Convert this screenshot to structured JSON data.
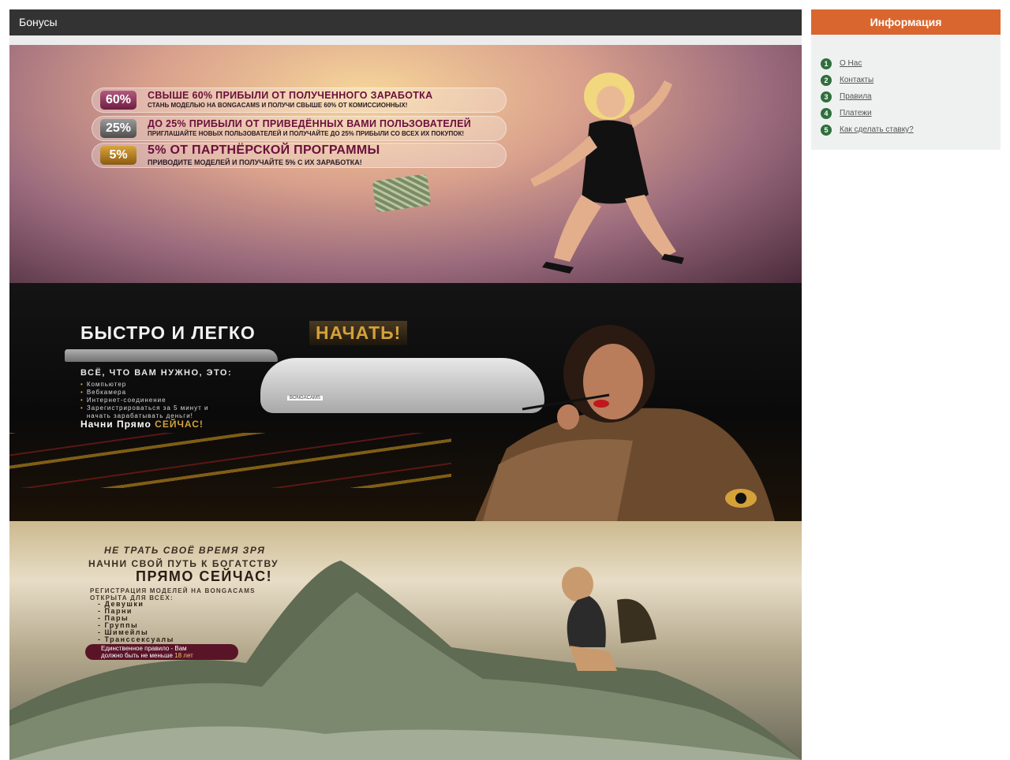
{
  "main": {
    "title": "Бонусы",
    "banners": [
      {
        "rows": [
          {
            "badge": "60%",
            "title": "СВЫШЕ 60% ПРИБЫЛИ ОТ ПОЛУЧЕННОГО ЗАРАБОТКА",
            "subtitle": "СТАНЬ МОДЕЛЬЮ НА BONGACAMS И ПОЛУЧИ СВЫШЕ 60% ОТ КОМИССИОННЫХ!"
          },
          {
            "badge": "25%",
            "title": "ДО 25% ПРИБЫЛИ ОТ ПРИВЕДЁННЫХ ВАМИ ПОЛЬЗОВАТЕЛЕЙ",
            "subtitle": "ПРИГЛАШАЙТЕ НОВЫХ ПОЛЬЗОВАТЕЛЕЙ И ПОЛУЧАЙТЕ ДО 25% ПРИБЫЛИ СО ВСЕХ ИХ ПОКУПОК!"
          },
          {
            "badge": "5%",
            "title": "5% ОТ ПАРТНЁРСКОЙ ПРОГРАММЫ",
            "subtitle": "ПРИВОДИТЕ МОДЕЛЕЙ И ПОЛУЧАЙТЕ 5% С ИХ ЗАРАБОТКА!"
          }
        ]
      },
      {
        "title": "БЫСТРО И ЛЕГКО",
        "title_accent": "НАЧАТЬ!",
        "intro": "ВСЁ, ЧТО ВАМ НУЖНО, ЭТО:",
        "list": [
          "Компьютер",
          "Вебкамера",
          "Интернет-соединение",
          "Зарегистрироваться за 5 минут и",
          "начать зарабатывать деньги!"
        ],
        "cta": "Начни Прямо",
        "cta_accent": "СЕЙЧАС!",
        "car_plate": "BONGACAMS"
      },
      {
        "line1": "НЕ ТРАТЬ СВОЁ ВРЕМЯ ЗРЯ",
        "line2": "НАЧНИ СВОЙ ПУТЬ К БОГАТСТВУ",
        "line3": "ПРЯМО СЕЙЧАС!",
        "intro": "РЕГИСТРАЦИЯ МОДЕЛЕЙ НА BONGACAMS ОТКРЫТА ДЛЯ ВСЕХ:",
        "list": [
          "- Девушки",
          "- Парни",
          "- Пары",
          "- Группы",
          "- Шимейлы",
          "- Транссексуалы"
        ],
        "rule": "Единственное правило - Вам",
        "rule2": "должно быть не меньше",
        "rule_age": "18 лет"
      }
    ]
  },
  "sidebar": {
    "title": "Информация",
    "items": [
      {
        "num": "1",
        "label": "О Нас"
      },
      {
        "num": "2",
        "label": "Контакты"
      },
      {
        "num": "3",
        "label": "Правила"
      },
      {
        "num": "4",
        "label": "Платежи"
      },
      {
        "num": "5",
        "label": "Как сделать ставку?"
      }
    ]
  }
}
